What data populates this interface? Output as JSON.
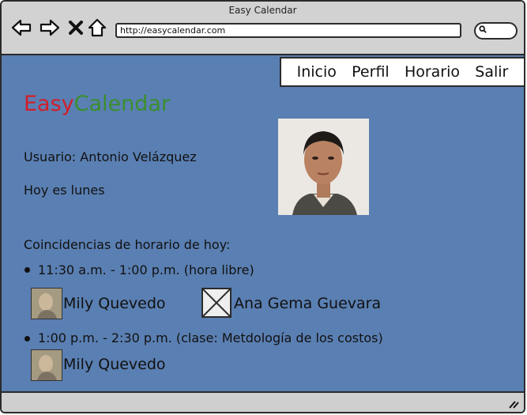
{
  "window": {
    "title": "Easy Calendar"
  },
  "browser": {
    "url": "http://easycalendar.com",
    "icons": [
      "back-arrow-icon",
      "forward-arrow-icon",
      "close-x-icon",
      "home-icon",
      "search-icon"
    ]
  },
  "menu": {
    "items": [
      "Inicio",
      "Perfil",
      "Horario",
      "Salir"
    ]
  },
  "logo": {
    "part1": "Easy",
    "part2": "Calendar",
    "colors": {
      "part1": "#d11f2a",
      "part2": "#3b8f2e"
    }
  },
  "user": {
    "label": "Usuario: Antonio Velázquez",
    "day": "Hoy es lunes"
  },
  "matches": {
    "heading": "Coincidencias de horario de hoy:",
    "slots": [
      {
        "time": "11:30 a.m. - 1:00 p.m. (hora libre)",
        "people": [
          "Mily Quevedo",
          "Ana Gema Guevara"
        ]
      },
      {
        "time": "1:00 p.m. - 2:30 p.m. (clase: Metdología de los costos)",
        "people": [
          "Mily Quevedo"
        ]
      }
    ]
  },
  "colors": {
    "content_bg": "#5a7fb2",
    "chrome_bg": "#d2d2d2"
  }
}
